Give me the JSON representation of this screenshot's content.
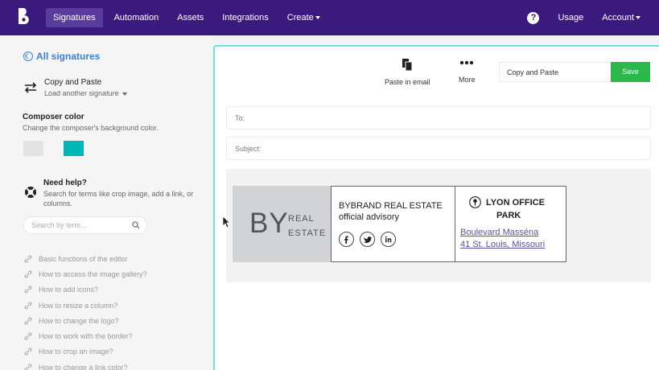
{
  "nav": {
    "items": [
      {
        "label": "Signatures",
        "active": true
      },
      {
        "label": "Automation"
      },
      {
        "label": "Assets"
      },
      {
        "label": "Integrations"
      },
      {
        "label": "Create"
      }
    ],
    "help": "?",
    "usage": "Usage",
    "account": "Account",
    "bg_color": "#3b1a7d"
  },
  "sidebar": {
    "back_link": "All signatures",
    "signature_title": "Copy and Paste",
    "load_another": "Load another signature",
    "composer_title": "Composer color",
    "composer_desc": "Change the composer's background color.",
    "swatches": [
      "#e3e3e3",
      "#f5f5f5",
      "#00b7b8"
    ],
    "help_title": "Need help?",
    "help_desc": "Search for terms like crop image, add a link, or columns.",
    "search_placeholder": "Search by term...",
    "help_links": [
      "Basic functions of the editor",
      "How to access the image gallery?",
      "How to add icons?",
      "How to resize a column?",
      "How to change the logo?",
      "How to work with the border?",
      "How to crop an image?",
      "How to change a link color?"
    ]
  },
  "toolbar": {
    "paste_label": "Paste in email",
    "more_label": "More",
    "name_value": "Copy and Paste",
    "save_label": "Save"
  },
  "fields": {
    "to_label": "To:",
    "subject_label": "Subject:"
  },
  "signature": {
    "logo_big": "BY",
    "logo_line1": "REAL",
    "logo_line2": "ESTATE",
    "company": "BYBRAND REAL ESTATE",
    "role": "official advisory",
    "social": [
      "facebook-icon",
      "twitter-icon",
      "linkedin-icon"
    ],
    "office_line1": "LYON OFFICE",
    "office_line2": "PARK",
    "address1": "Boulevard Masséna",
    "address2": "41 St. Louis, Missouri"
  }
}
